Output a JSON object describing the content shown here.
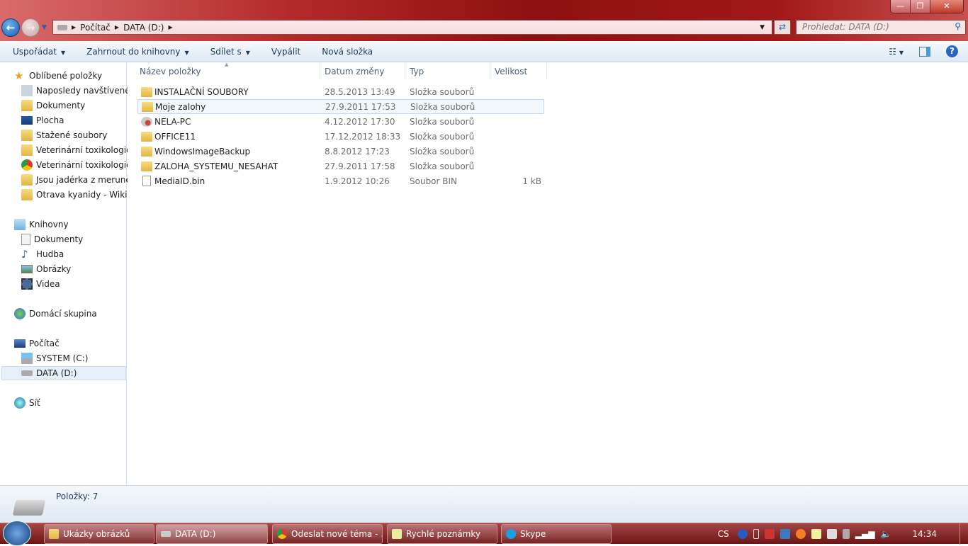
{
  "window": {
    "minimize": "—",
    "restore": "❐",
    "close": "✕"
  },
  "address": {
    "segments": [
      "Počítač",
      "DATA (D:)"
    ],
    "search_placeholder": "Prohledat: DATA (D:)"
  },
  "toolbar": {
    "organize": "Uspořádat",
    "include": "Zahrnout do knihovny",
    "share": "Sdílet s",
    "burn": "Vypálit",
    "new_folder": "Nová složka",
    "help": "?"
  },
  "sidebar": {
    "favorites": {
      "label": "Oblíbené položky",
      "items": [
        "Naposledy navštívené",
        "Dokumenty",
        "Plocha",
        "Stažené soubory",
        "Veterinární toxikologická",
        "Veterinární toxikologická",
        "Jsou jadérka z meruněk jedovatá",
        "Otrava kyanidy - Wikipedie"
      ]
    },
    "libraries": {
      "label": "Knihovny",
      "items": [
        "Dokumenty",
        "Hudba",
        "Obrázky",
        "Videa"
      ]
    },
    "homegroup": "Domácí skupina",
    "computer": {
      "label": "Počítač",
      "items": [
        "SYSTEM (C:)",
        "DATA (D:)"
      ]
    },
    "network": "Síť"
  },
  "columns": {
    "name": "Název položky",
    "date": "Datum změny",
    "type": "Typ",
    "size": "Velikost"
  },
  "files": [
    {
      "name": "INSTALAČNÍ SOUBORY",
      "date": "28.5.2013 13:49",
      "type": "Složka souborů",
      "size": "",
      "icon": "folder"
    },
    {
      "name": "Moje zalohy",
      "date": "27.9.2011 17:53",
      "type": "Složka souborů",
      "size": "",
      "icon": "folder"
    },
    {
      "name": "NELA-PC",
      "date": "4.12.2012 17:30",
      "type": "Složka souborů",
      "size": "",
      "icon": "network-folder"
    },
    {
      "name": "OFFICE11",
      "date": "17.12.2012 18:33",
      "type": "Složka souborů",
      "size": "",
      "icon": "folder"
    },
    {
      "name": "WindowsImageBackup",
      "date": "8.8.2012 17:23",
      "type": "Složka souborů",
      "size": "",
      "icon": "folder"
    },
    {
      "name": "ZALOHA_SYSTEMU_NESAHAT",
      "date": "27.9.2011 17:58",
      "type": "Složka souborů",
      "size": "",
      "icon": "folder"
    },
    {
      "name": "MediaID.bin",
      "date": "1.9.2012 10:26",
      "type": "Soubor BIN",
      "size": "1 kB",
      "icon": "file"
    }
  ],
  "status": {
    "items": "Položky: 7"
  },
  "taskbar": {
    "tasks": [
      "Ukázky obrázků",
      "DATA (D:)",
      "Odeslat nové téma - ...",
      "Rychlé poznámky",
      "Skype"
    ],
    "lang": "CS",
    "time": "14:34"
  }
}
